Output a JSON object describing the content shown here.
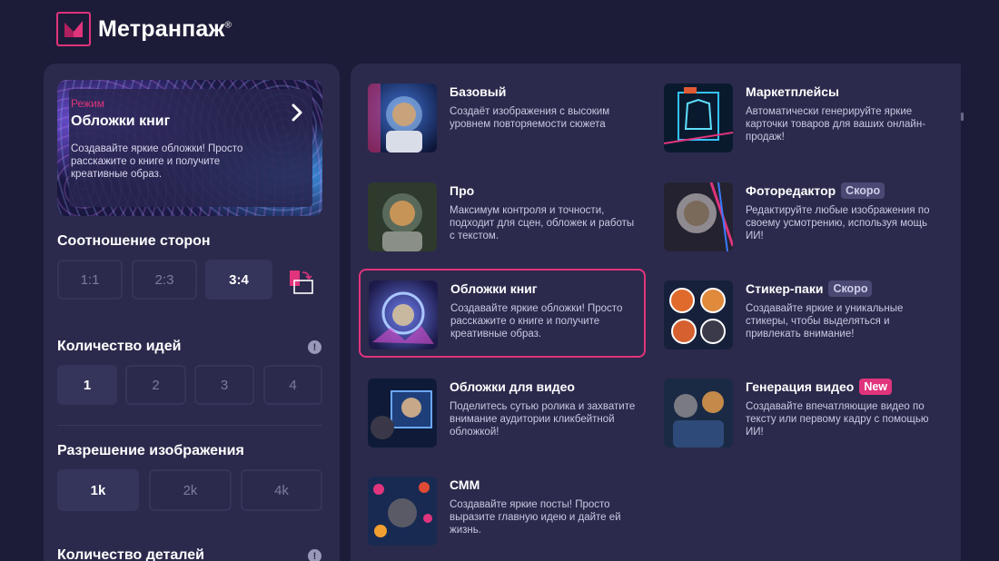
{
  "header": {
    "brand": "Метранпаж",
    "registered": "®"
  },
  "mode_card": {
    "label": "Режим",
    "title": "Обложки книг",
    "description": "Создавайте яркие обложки! Просто расскажите о книге и получите креативные образ."
  },
  "aspect": {
    "title": "Соотношение сторон",
    "options": [
      "1:1",
      "2:3",
      "3:4"
    ],
    "selected": "3:4"
  },
  "ideas": {
    "title": "Количество идей",
    "options": [
      "1",
      "2",
      "3",
      "4"
    ],
    "selected": "1",
    "info_icon": "!"
  },
  "resolution": {
    "title": "Разрешение изображения",
    "options": [
      "1k",
      "2k",
      "4k"
    ],
    "selected": "1k"
  },
  "details": {
    "title": "Количество деталей",
    "info_icon": "!"
  },
  "modes": [
    {
      "id": "base",
      "title": "Базовый",
      "badge": "",
      "description": "Создаёт изображения с высоким уровнем повторяемости сюжета"
    },
    {
      "id": "marketplaces",
      "title": "Маркетплейсы",
      "badge": "",
      "description": "Автоматически генерируйте яркие карточки товаров для ваших онлайн-продаж!"
    },
    {
      "id": "pro",
      "title": "Про",
      "badge": "",
      "description": "Максимум контроля и точности, подходит для сцен, обложек и работы с текстом."
    },
    {
      "id": "photo-editor",
      "title": "Фоторедактор",
      "badge": "Скоро",
      "description": "Редактируйте любые изображения по своему усмотрению, используя мощь ИИ!"
    },
    {
      "id": "book-covers",
      "title": "Обложки книг",
      "badge": "",
      "description": "Создавайте яркие обложки! Просто расскажите о книге и получите креативные образ."
    },
    {
      "id": "sticker-packs",
      "title": "Стикер-паки",
      "badge": "Скоро",
      "description": "Создавайте яркие и уникальные стикеры, чтобы выделяться и привлекать внимание!"
    },
    {
      "id": "video-covers",
      "title": "Обложки для видео",
      "badge": "",
      "description": "Поделитесь сутью ролика и захватите внимание аудитории кликбейтной обложкой!"
    },
    {
      "id": "video-generation",
      "title": "Генерация видео",
      "badge": "New",
      "description": "Создавайте впечатляющие видео по тексту или первому кадру с помощью ИИ!"
    },
    {
      "id": "smm",
      "title": "СММ",
      "badge": "",
      "description": "Создавайте яркие посты! Просто выразите главную идею и дайте ей жизнь."
    }
  ],
  "selected_mode": "book-covers",
  "colors": {
    "accent": "#e0347c",
    "background": "#1d1c38",
    "panel": "#2b2a4c",
    "option_active": "#35345a"
  }
}
